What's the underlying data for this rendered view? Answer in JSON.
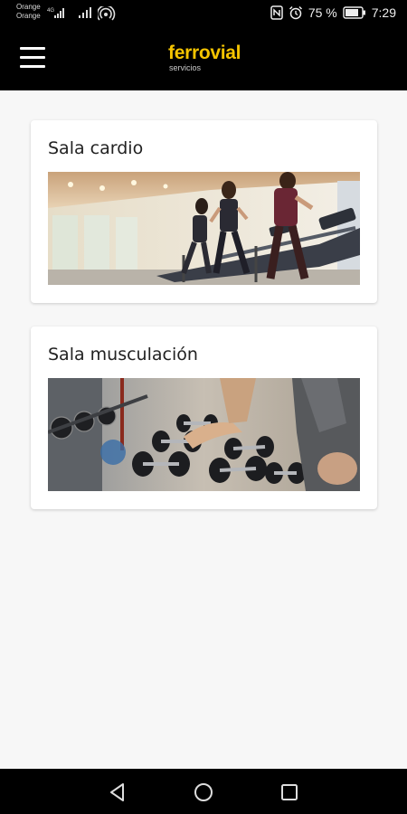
{
  "status_bar": {
    "carrier_1": "Orange",
    "carrier_2": "Orange",
    "network_1": "4G",
    "battery_percent": "75 %",
    "time": "7:29"
  },
  "app_bar": {
    "logo_main": "ferrovial",
    "logo_sub": "servicios",
    "logo_color": "#f5c400"
  },
  "rooms": [
    {
      "title": "Sala cardio"
    },
    {
      "title": "Sala musculación"
    }
  ],
  "icons": [
    "menu-icon",
    "nfc-icon",
    "alarm-icon",
    "battery-icon",
    "back-icon",
    "home-icon",
    "recent-apps-icon"
  ]
}
